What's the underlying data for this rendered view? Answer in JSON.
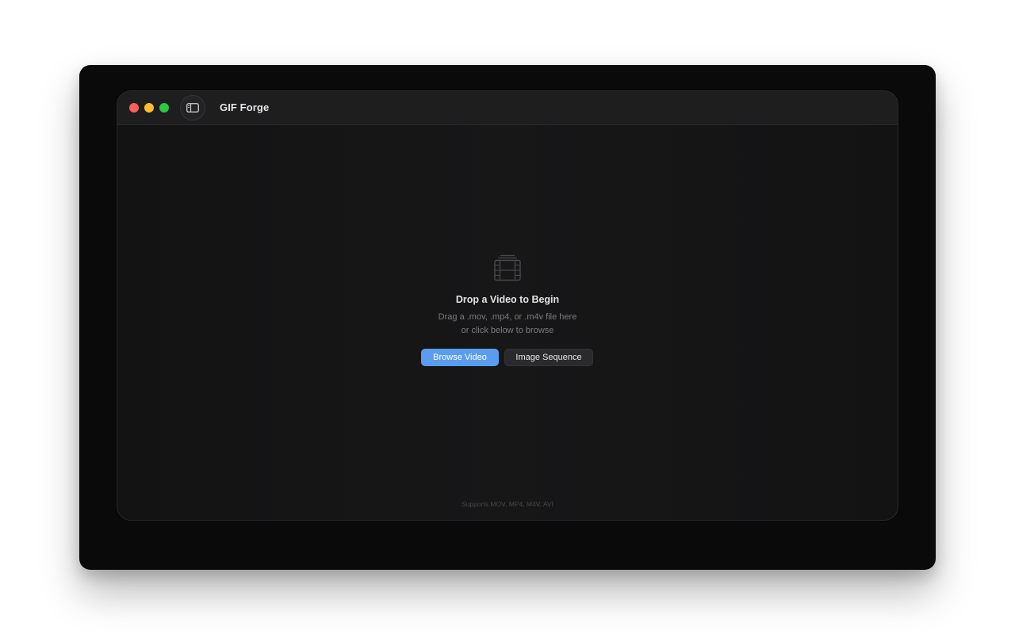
{
  "window": {
    "title": "GIF Forge"
  },
  "titlebar": {
    "controls": [
      "close",
      "minimize",
      "zoom"
    ],
    "sidebar_toggle_icon": "sidebar-icon"
  },
  "drop_zone": {
    "icon": "film-icon",
    "title": "Drop a Video to Begin",
    "line1": "Drag a .mov, .mp4, or .m4v file here",
    "line2": "or click below to browse",
    "browse_label": "Browse Video",
    "sequence_label": "Image Sequence"
  },
  "footer": {
    "supported": "Supports MOV, MP4, M4V, AVI"
  },
  "colors": {
    "accent": "#5a9df0",
    "close": "#ff5f57",
    "minimize": "#febc2e",
    "zoom": "#28c840"
  }
}
